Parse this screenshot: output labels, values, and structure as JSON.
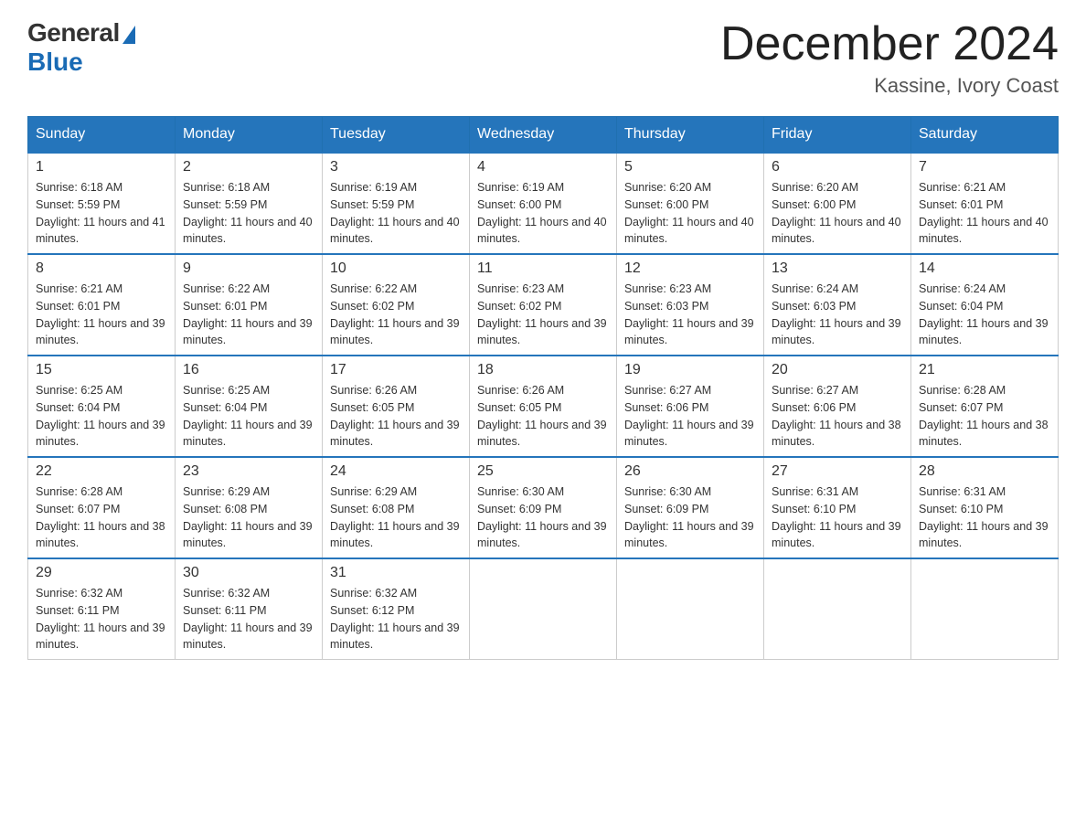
{
  "header": {
    "logo_general": "General",
    "logo_blue": "Blue",
    "month_title": "December 2024",
    "location": "Kassine, Ivory Coast"
  },
  "days_of_week": [
    "Sunday",
    "Monday",
    "Tuesday",
    "Wednesday",
    "Thursday",
    "Friday",
    "Saturday"
  ],
  "weeks": [
    [
      {
        "day": "1",
        "sunrise": "6:18 AM",
        "sunset": "5:59 PM",
        "daylight": "11 hours and 41 minutes."
      },
      {
        "day": "2",
        "sunrise": "6:18 AM",
        "sunset": "5:59 PM",
        "daylight": "11 hours and 40 minutes."
      },
      {
        "day": "3",
        "sunrise": "6:19 AM",
        "sunset": "5:59 PM",
        "daylight": "11 hours and 40 minutes."
      },
      {
        "day": "4",
        "sunrise": "6:19 AM",
        "sunset": "6:00 PM",
        "daylight": "11 hours and 40 minutes."
      },
      {
        "day": "5",
        "sunrise": "6:20 AM",
        "sunset": "6:00 PM",
        "daylight": "11 hours and 40 minutes."
      },
      {
        "day": "6",
        "sunrise": "6:20 AM",
        "sunset": "6:00 PM",
        "daylight": "11 hours and 40 minutes."
      },
      {
        "day": "7",
        "sunrise": "6:21 AM",
        "sunset": "6:01 PM",
        "daylight": "11 hours and 40 minutes."
      }
    ],
    [
      {
        "day": "8",
        "sunrise": "6:21 AM",
        "sunset": "6:01 PM",
        "daylight": "11 hours and 39 minutes."
      },
      {
        "day": "9",
        "sunrise": "6:22 AM",
        "sunset": "6:01 PM",
        "daylight": "11 hours and 39 minutes."
      },
      {
        "day": "10",
        "sunrise": "6:22 AM",
        "sunset": "6:02 PM",
        "daylight": "11 hours and 39 minutes."
      },
      {
        "day": "11",
        "sunrise": "6:23 AM",
        "sunset": "6:02 PM",
        "daylight": "11 hours and 39 minutes."
      },
      {
        "day": "12",
        "sunrise": "6:23 AM",
        "sunset": "6:03 PM",
        "daylight": "11 hours and 39 minutes."
      },
      {
        "day": "13",
        "sunrise": "6:24 AM",
        "sunset": "6:03 PM",
        "daylight": "11 hours and 39 minutes."
      },
      {
        "day": "14",
        "sunrise": "6:24 AM",
        "sunset": "6:04 PM",
        "daylight": "11 hours and 39 minutes."
      }
    ],
    [
      {
        "day": "15",
        "sunrise": "6:25 AM",
        "sunset": "6:04 PM",
        "daylight": "11 hours and 39 minutes."
      },
      {
        "day": "16",
        "sunrise": "6:25 AM",
        "sunset": "6:04 PM",
        "daylight": "11 hours and 39 minutes."
      },
      {
        "day": "17",
        "sunrise": "6:26 AM",
        "sunset": "6:05 PM",
        "daylight": "11 hours and 39 minutes."
      },
      {
        "day": "18",
        "sunrise": "6:26 AM",
        "sunset": "6:05 PM",
        "daylight": "11 hours and 39 minutes."
      },
      {
        "day": "19",
        "sunrise": "6:27 AM",
        "sunset": "6:06 PM",
        "daylight": "11 hours and 39 minutes."
      },
      {
        "day": "20",
        "sunrise": "6:27 AM",
        "sunset": "6:06 PM",
        "daylight": "11 hours and 38 minutes."
      },
      {
        "day": "21",
        "sunrise": "6:28 AM",
        "sunset": "6:07 PM",
        "daylight": "11 hours and 38 minutes."
      }
    ],
    [
      {
        "day": "22",
        "sunrise": "6:28 AM",
        "sunset": "6:07 PM",
        "daylight": "11 hours and 38 minutes."
      },
      {
        "day": "23",
        "sunrise": "6:29 AM",
        "sunset": "6:08 PM",
        "daylight": "11 hours and 39 minutes."
      },
      {
        "day": "24",
        "sunrise": "6:29 AM",
        "sunset": "6:08 PM",
        "daylight": "11 hours and 39 minutes."
      },
      {
        "day": "25",
        "sunrise": "6:30 AM",
        "sunset": "6:09 PM",
        "daylight": "11 hours and 39 minutes."
      },
      {
        "day": "26",
        "sunrise": "6:30 AM",
        "sunset": "6:09 PM",
        "daylight": "11 hours and 39 minutes."
      },
      {
        "day": "27",
        "sunrise": "6:31 AM",
        "sunset": "6:10 PM",
        "daylight": "11 hours and 39 minutes."
      },
      {
        "day": "28",
        "sunrise": "6:31 AM",
        "sunset": "6:10 PM",
        "daylight": "11 hours and 39 minutes."
      }
    ],
    [
      {
        "day": "29",
        "sunrise": "6:32 AM",
        "sunset": "6:11 PM",
        "daylight": "11 hours and 39 minutes."
      },
      {
        "day": "30",
        "sunrise": "6:32 AM",
        "sunset": "6:11 PM",
        "daylight": "11 hours and 39 minutes."
      },
      {
        "day": "31",
        "sunrise": "6:32 AM",
        "sunset": "6:12 PM",
        "daylight": "11 hours and 39 minutes."
      },
      null,
      null,
      null,
      null
    ]
  ]
}
